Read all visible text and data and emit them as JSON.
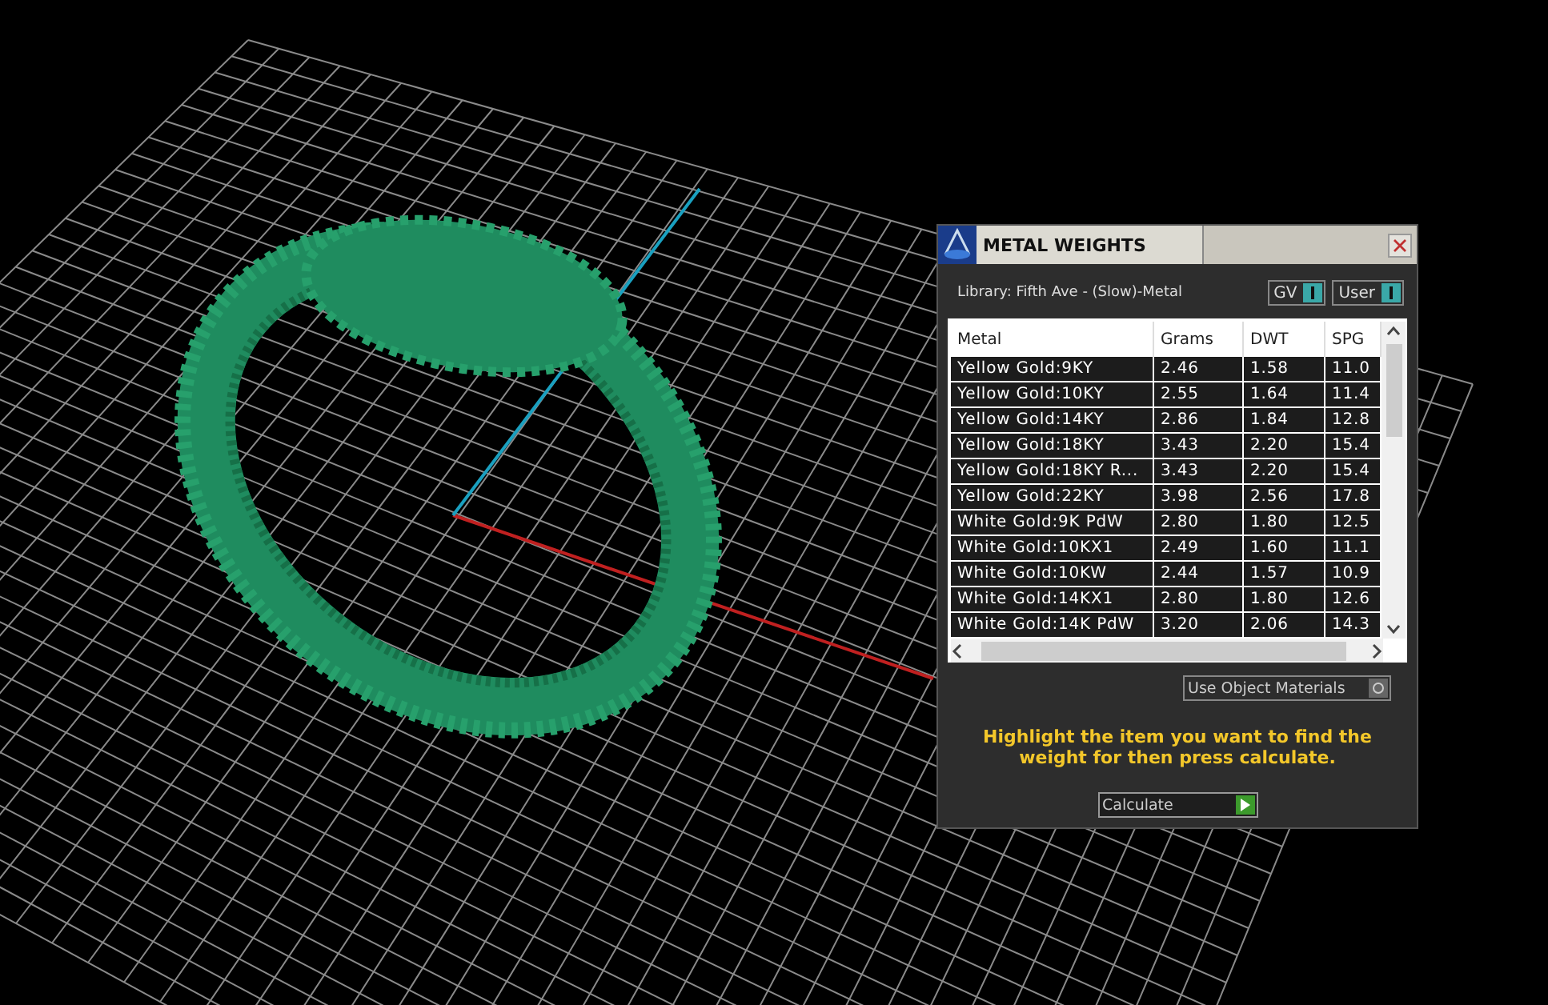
{
  "window": {
    "title": "METAL WEIGHTS"
  },
  "library": "Library: Fifth Ave - (Slow)-Metal",
  "toggles": [
    {
      "label": "GV",
      "on": true
    },
    {
      "label": "User",
      "on": true
    }
  ],
  "table": {
    "columns": [
      "Metal",
      "Grams",
      "DWT",
      "SPG"
    ],
    "rows": [
      {
        "cells": [
          "Yellow Gold:9KY",
          "2.46",
          "1.58",
          "11.0"
        ],
        "selected": false
      },
      {
        "cells": [
          "Yellow Gold:10KY",
          "2.55",
          "1.64",
          "11.4"
        ],
        "selected": false
      },
      {
        "cells": [
          "Yellow Gold:14KY",
          "2.86",
          "1.84",
          "12.8"
        ],
        "selected": false
      },
      {
        "cells": [
          "Yellow Gold:18KY",
          "3.43",
          "2.20",
          "15.4"
        ],
        "selected": false
      },
      {
        "cells": [
          "Yellow Gold:18KY R...",
          "3.43",
          "2.20",
          "15.4"
        ],
        "selected": false
      },
      {
        "cells": [
          "Yellow Gold:22KY",
          "3.98",
          "2.56",
          "17.8"
        ],
        "selected": false
      },
      {
        "cells": [
          "White Gold:9K PdW",
          "2.80",
          "1.80",
          "12.5"
        ],
        "selected": false
      },
      {
        "cells": [
          "White Gold:10KX1",
          "2.49",
          "1.60",
          "11.1"
        ],
        "selected": false
      },
      {
        "cells": [
          "White Gold:10KW",
          "2.44",
          "1.57",
          "10.9"
        ],
        "selected": false
      },
      {
        "cells": [
          "White Gold:14KX1",
          "2.80",
          "1.80",
          "12.6"
        ],
        "selected": false
      },
      {
        "cells": [
          "White Gold:14K PdW",
          "3.20",
          "2.06",
          "14.3"
        ],
        "selected": false
      }
    ]
  },
  "use_object_materials": {
    "label": "Use Object Materials",
    "on": false
  },
  "instruction": "Highlight the item you want to find the weight for then press calculate.",
  "calculate_button": "Calculate"
}
